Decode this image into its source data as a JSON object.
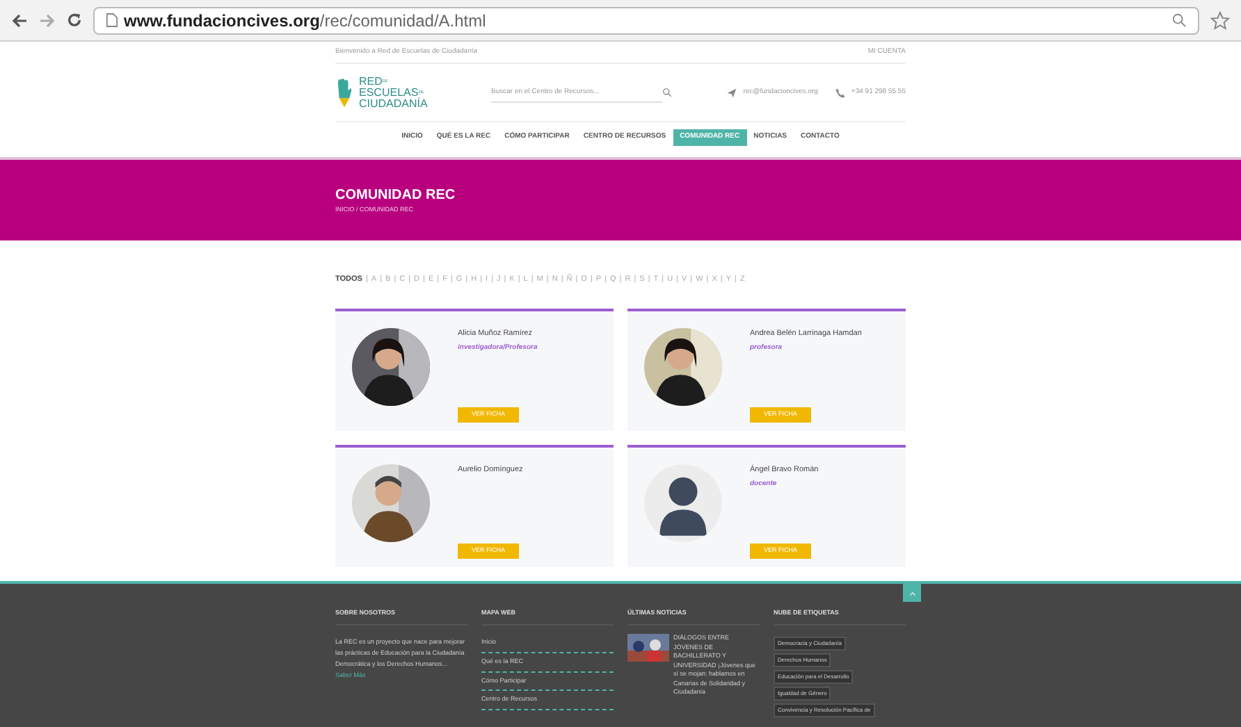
{
  "browser": {
    "url_host": "www.fundacioncives.org",
    "url_path": "/rec/comunidad/A.html"
  },
  "topbar": {
    "welcome": "Bienvenido a Red de Escuelas de Ciudadanía",
    "account": "MI CUENTA"
  },
  "header": {
    "logo": [
      "RED",
      "ESCUELAS",
      "CIUDADANÍA"
    ],
    "logo_small": [
      "DE",
      "DE"
    ],
    "search": {
      "placeholder": "Buscar en el Centro de Recursos..."
    },
    "email": "rec@fundacioncives.org",
    "phone": "+34 91 298 55 55"
  },
  "nav": [
    {
      "label": "INICIO",
      "selected": false
    },
    {
      "label": "QUÉ ES LA REC",
      "selected": false
    },
    {
      "label": "CÓMO PARTICIPAR",
      "selected": false
    },
    {
      "label": "CENTRO DE RECURSOS",
      "selected": false
    },
    {
      "label": "COMUNIDAD REC",
      "selected": true
    },
    {
      "label": "NOTICIAS",
      "selected": false
    },
    {
      "label": "CONTACTO",
      "selected": false
    }
  ],
  "hero": {
    "title": "COMUNIDAD REC",
    "breadcrumb": "INICIO / COMUNIDAD REC"
  },
  "alphabet": {
    "separator": "|",
    "items": [
      {
        "label": "TODOS",
        "selected": true
      },
      {
        "label": "A",
        "selected": false
      },
      {
        "label": "B",
        "selected": false
      },
      {
        "label": "C",
        "selected": false
      },
      {
        "label": "D",
        "selected": false
      },
      {
        "label": "E",
        "selected": false
      },
      {
        "label": "F",
        "selected": false
      },
      {
        "label": "G",
        "selected": false
      },
      {
        "label": "H",
        "selected": false
      },
      {
        "label": "I",
        "selected": false
      },
      {
        "label": "J",
        "selected": false
      },
      {
        "label": "K",
        "selected": false
      },
      {
        "label": "L",
        "selected": false
      },
      {
        "label": "M",
        "selected": false
      },
      {
        "label": "N",
        "selected": false
      },
      {
        "label": "Ñ",
        "selected": false
      },
      {
        "label": "O",
        "selected": false
      },
      {
        "label": "P",
        "selected": false
      },
      {
        "label": "Q",
        "selected": false
      },
      {
        "label": "R",
        "selected": false
      },
      {
        "label": "S",
        "selected": false
      },
      {
        "label": "T",
        "selected": false
      },
      {
        "label": "U",
        "selected": false
      },
      {
        "label": "V",
        "selected": false
      },
      {
        "label": "W",
        "selected": false
      },
      {
        "label": "X",
        "selected": false
      },
      {
        "label": "Y",
        "selected": false
      },
      {
        "label": "Z",
        "selected": false
      }
    ]
  },
  "members": [
    {
      "name": "Alicia Muñoz Ramírez",
      "role": "investigadora/Profesora",
      "button": "VER FICHA"
    },
    {
      "name": "Andrea Belén Larrinaga Hamdan",
      "role": "profesora",
      "button": "VER FICHA"
    },
    {
      "name": "Aurelio Domínguez",
      "button": "VER FICHA"
    },
    {
      "name": "Ángel Bravo Román",
      "role": "docente",
      "avatar": {
        "kind": "default"
      },
      "button": "VER FICHA"
    }
  ],
  "footer": {
    "about": {
      "title": "SOBRE NOSOTROS",
      "text": "La REC es un proyecto que nace para mejorar las prácticas de Educación para la Ciudadanía Democrática y los Derechos Humanos...",
      "link": "Saber Más"
    },
    "map": {
      "title": "MAPA WEB",
      "links": [
        "Inicio",
        "Qué es la REC",
        "Cómo Participar",
        "Centro de Recursos"
      ]
    },
    "news": {
      "title": "ÚLTIMAS NOTICIAS",
      "items": [
        {
          "text": "DIÁLOGOS ENTRE JÓVENES DE BACHILLERATO Y UNIVERSIDAD ¡Jóvenes que sí se mojan: hablamos en Canarias de Solidaridad y Ciudadanía"
        }
      ]
    },
    "tags": {
      "title": "NUBE DE ETIQUETAS",
      "items": [
        "Democracia y Ciudadanía",
        "Derechos Humanos",
        "Educación para el Desarrollo",
        "Igualdad de Género",
        "Convivencia y Resolución Pacífica de"
      ]
    }
  }
}
